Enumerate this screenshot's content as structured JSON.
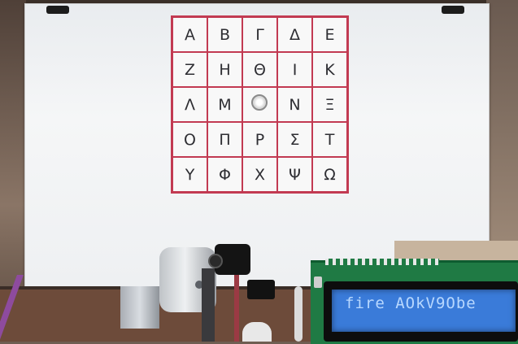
{
  "grid": {
    "rows": [
      [
        "Α",
        "Β",
        "Γ",
        "Δ",
        "Ε"
      ],
      [
        "Ζ",
        "Η",
        "Θ",
        "Ι",
        "Κ"
      ],
      [
        "Λ",
        "Μ",
        "",
        "Ν",
        "Ξ"
      ],
      [
        "Ο",
        "Π",
        "Ρ",
        "Σ",
        "Τ"
      ],
      [
        "Υ",
        "Φ",
        "Χ",
        "Ψ",
        "Ω"
      ]
    ],
    "border_color": "#c23a52"
  },
  "lcd": {
    "text": "fire AOkV9Obe",
    "background_color": "#3a7bd9",
    "text_color": "#b8d8ff"
  },
  "icons": {
    "laser_dot": "laser-dot-icon"
  }
}
